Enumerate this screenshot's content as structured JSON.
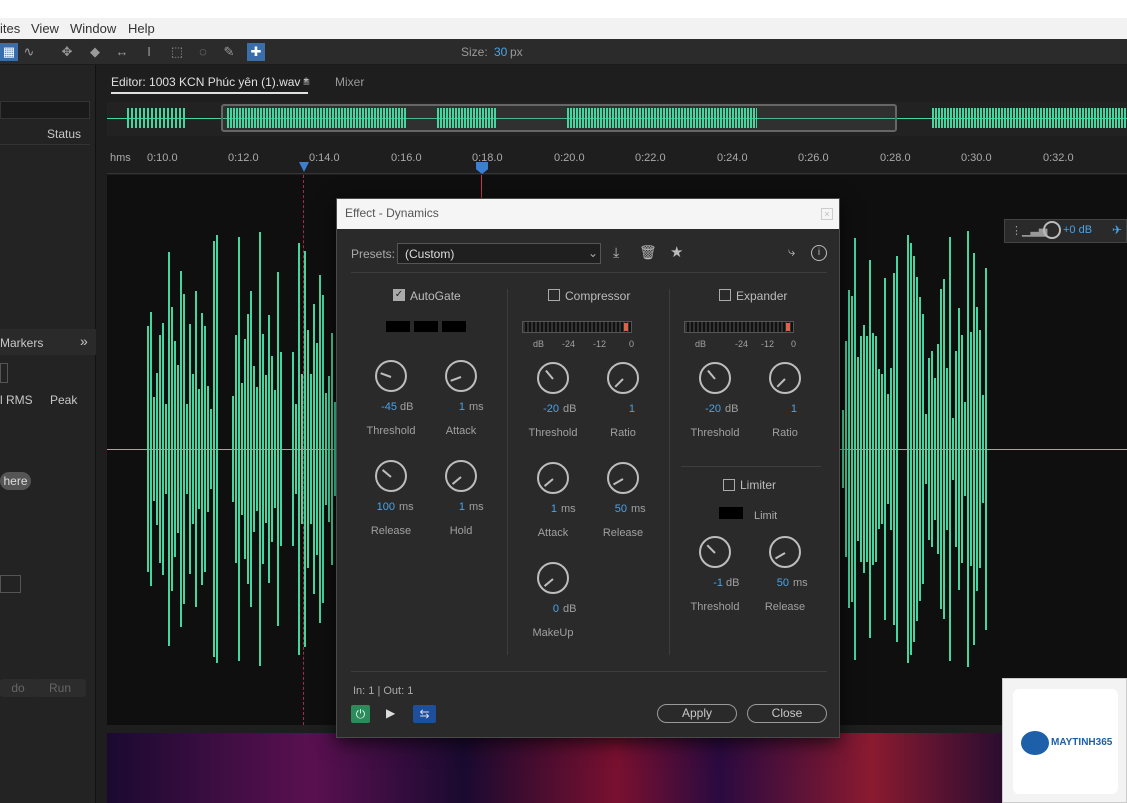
{
  "menubar": {
    "items": [
      "ites",
      "View",
      "Window",
      "Help"
    ]
  },
  "toolbar": {
    "size_label": "Size:",
    "size_value": "30",
    "size_unit": "px"
  },
  "tabs": {
    "editor": "Editor: 1003 KCN Phúc yên (1).wav *",
    "mixer": "Mixer"
  },
  "leftpanel": {
    "status": "Status",
    "markers": "Markers",
    "rms": "l RMS",
    "peak": "Peak",
    "here": "here",
    "undo": "do",
    "run": "Run"
  },
  "ruler": {
    "unit": "hms",
    "ticks": [
      "0:10.0",
      "0:12.0",
      "0:14.0",
      "0:16.0",
      "0:18.0",
      "0:20.0",
      "0:22.0",
      "0:24.0",
      "0:26.0",
      "0:28.0",
      "0:30.0",
      "0:32.0"
    ]
  },
  "hud": {
    "gain": "+0 dB"
  },
  "dialog": {
    "title": "Effect - Dynamics",
    "presets_label": "Presets:",
    "presets_value": "(Custom)",
    "autogate": {
      "label": "AutoGate",
      "checked": true,
      "threshold": {
        "value": "-45",
        "unit": "dB",
        "label": "Threshold"
      },
      "attack": {
        "value": "1",
        "unit": "ms",
        "label": "Attack"
      },
      "release": {
        "value": "100",
        "unit": "ms",
        "label": "Release"
      },
      "hold": {
        "value": "1",
        "unit": "ms",
        "label": "Hold"
      }
    },
    "compressor": {
      "label": "Compressor",
      "checked": false,
      "meter_labels": [
        "dB",
        "-24",
        "-12",
        "0"
      ],
      "threshold": {
        "value": "-20",
        "unit": "dB",
        "label": "Threshold"
      },
      "ratio": {
        "value": "1",
        "label": "Ratio"
      },
      "attack": {
        "value": "1",
        "unit": "ms",
        "label": "Attack"
      },
      "release": {
        "value": "50",
        "unit": "ms",
        "label": "Release"
      },
      "makeup": {
        "value": "0",
        "unit": "dB",
        "label": "MakeUp"
      }
    },
    "expander": {
      "label": "Expander",
      "checked": false,
      "meter_labels": [
        "dB",
        "-24",
        "-12",
        "0"
      ],
      "threshold": {
        "value": "-20",
        "unit": "dB",
        "label": "Threshold"
      },
      "ratio": {
        "value": "1",
        "label": "Ratio"
      }
    },
    "limiter": {
      "label": "Limiter",
      "checked": false,
      "limit_label": "Limit",
      "threshold": {
        "value": "-1",
        "unit": "dB",
        "label": "Threshold"
      },
      "release": {
        "value": "50",
        "unit": "ms",
        "label": "Release"
      }
    },
    "io": "In: 1 | Out: 1",
    "apply": "Apply",
    "close": "Close"
  },
  "watermark": {
    "brand": "MAYTINH365"
  }
}
